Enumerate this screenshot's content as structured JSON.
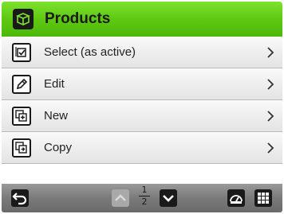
{
  "header": {
    "title": "Products",
    "icon": "products-cube-icon",
    "color": "#5ec811"
  },
  "menu": [
    {
      "label": "Select (as active)",
      "icon": "select-check-icon"
    },
    {
      "label": "Edit",
      "icon": "edit-pencil-icon"
    },
    {
      "label": "New",
      "icon": "new-plus-icon"
    },
    {
      "label": "Copy",
      "icon": "copy-icon"
    }
  ],
  "pager": {
    "current": "1",
    "total": "2"
  },
  "bottombar": {
    "back_icon": "back-arrow-icon",
    "page_up_icon": "page-up-icon",
    "page_down_icon": "page-down-icon",
    "dashboard_icon": "dashboard-gauge-icon",
    "menu_icon": "grid-menu-icon"
  }
}
